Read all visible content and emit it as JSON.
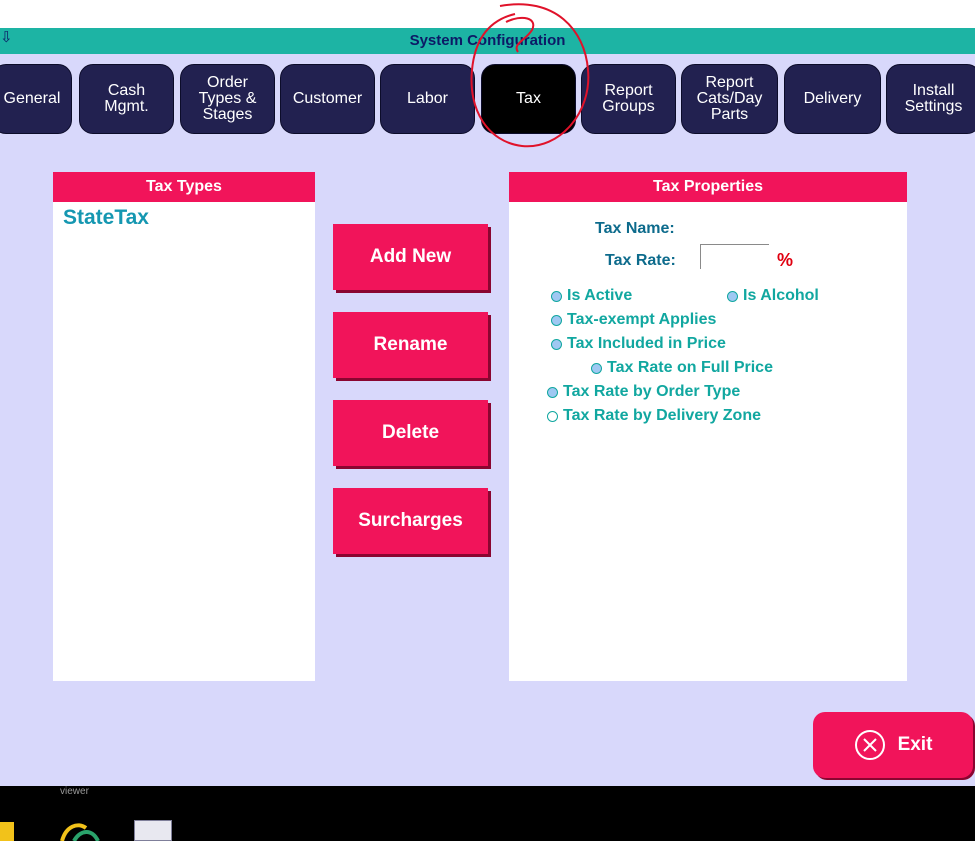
{
  "window": {
    "title": "System Configuration"
  },
  "tabs": [
    {
      "label": "General",
      "active": false
    },
    {
      "label": "Cash\nMgmt.",
      "active": false
    },
    {
      "label": "Order\nTypes &\nStages",
      "active": false
    },
    {
      "label": "Customer",
      "active": false
    },
    {
      "label": "Labor",
      "active": false
    },
    {
      "label": "Tax",
      "active": true
    },
    {
      "label": "Report\nGroups",
      "active": false
    },
    {
      "label": "Report\nCats/Day\nParts",
      "active": false
    },
    {
      "label": "Delivery",
      "active": false
    },
    {
      "label": "Install\nSettings",
      "active": false
    }
  ],
  "tax_types": {
    "header": "Tax Types",
    "items": [
      "StateTax"
    ]
  },
  "actions": {
    "add_new": "Add New",
    "rename": "Rename",
    "delete": "Delete",
    "surcharges": "Surcharges"
  },
  "tax_properties": {
    "header": "Tax Properties",
    "name_label": "Tax Name:",
    "rate_label": "Tax Rate:",
    "rate_value": "",
    "percent_symbol": "%",
    "options": [
      {
        "label": "Is Active",
        "checked": true
      },
      {
        "label": "Is Alcohol",
        "checked": true
      },
      {
        "label": "Tax-exempt Applies",
        "checked": true
      },
      {
        "label": "Tax Included in Price",
        "checked": true
      },
      {
        "label": "Tax Rate on Full Price",
        "checked": true
      },
      {
        "label": "Tax Rate by Order Type",
        "checked": true
      },
      {
        "label": "Tax Rate by Delivery Zone",
        "checked": false
      }
    ]
  },
  "exit_button": {
    "label": "Exit"
  },
  "taskbar": {
    "viewer_text": "viewer"
  },
  "colors": {
    "accent": "#f1145a",
    "tab_bg": "#222150",
    "title_bar": "#1db4a4",
    "background": "#d8d8fb"
  }
}
